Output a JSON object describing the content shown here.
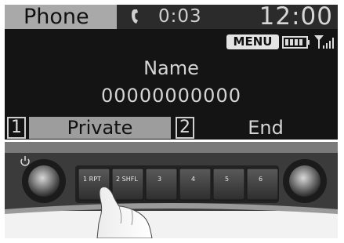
{
  "status_bar": {
    "app_title": "Phone",
    "call_timer": "0:03",
    "clock": "12:00",
    "call_icon": "phone-handset-icon"
  },
  "indicators": {
    "menu_label": "MENU",
    "battery_icon": "battery-icon",
    "signal_icon": "signal-strength-icon"
  },
  "caller": {
    "name": "Name",
    "number": "00000000000"
  },
  "softkeys": [
    {
      "number": "1",
      "label": "Private"
    },
    {
      "number": "2",
      "label": "End"
    }
  ],
  "button_panel": {
    "presets": [
      {
        "label": "1 RPT"
      },
      {
        "label": "2 SHFL"
      },
      {
        "label": "3"
      },
      {
        "label": "4"
      },
      {
        "label": "5"
      },
      {
        "label": "6"
      }
    ],
    "left_knob": "power-volume-knob",
    "right_knob": "tune-knob",
    "power_icon": "power-icon"
  },
  "colors": {
    "display_bg": "#141414",
    "tab_bg": "#a9a9a9",
    "softkey_highlight": "#9d9d9d",
    "text_light": "#d4d4d4"
  }
}
